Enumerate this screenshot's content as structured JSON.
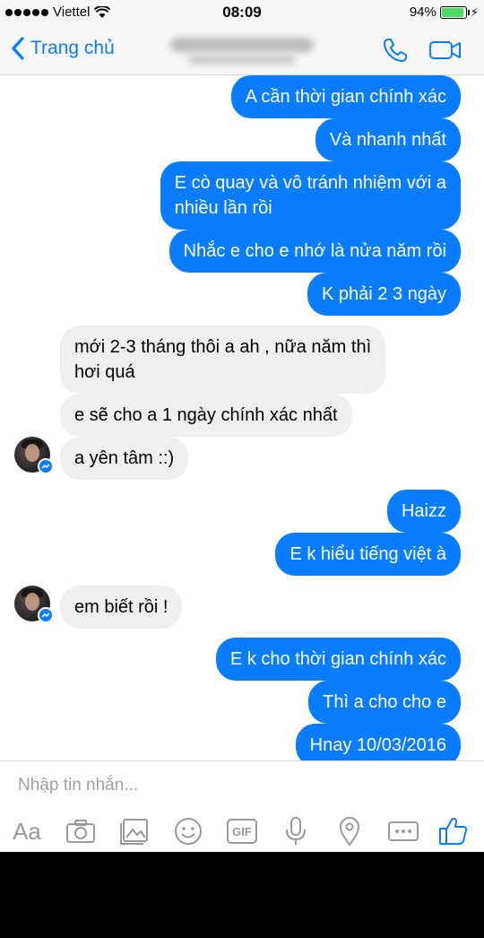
{
  "status_bar": {
    "carrier": "Viettel",
    "time": "08:09",
    "battery_percent": "94%",
    "battery_level": 0.94
  },
  "nav": {
    "back_label": "Trang chủ",
    "contact_name": ""
  },
  "messages": [
    {
      "id": "m1",
      "side": "out",
      "text": "A cần thời gian chính xác"
    },
    {
      "id": "m2",
      "side": "out",
      "text": "Và nhanh nhất"
    },
    {
      "id": "m3",
      "side": "out",
      "text": "E cò quay và vô tránh nhiệm với a\nnhiều lần rồi"
    },
    {
      "id": "m4",
      "side": "out",
      "text": "Nhắc e cho e nhớ là nửa năm rồi"
    },
    {
      "id": "m5",
      "side": "out",
      "text": "K phải 2 3 ngày"
    },
    {
      "id": "m6",
      "side": "in",
      "text": "mới 2-3 tháng thôi a ah , nữa năm thì\nhơi quá"
    },
    {
      "id": "m7",
      "side": "in",
      "text": "e sẽ cho a 1 ngày chính xác nhất"
    },
    {
      "id": "m8",
      "side": "in",
      "text": "a yên tâm ::)"
    },
    {
      "id": "m9",
      "side": "out",
      "text": "Haizz"
    },
    {
      "id": "m10",
      "side": "out",
      "text": "E k hiểu tiếng việt à"
    },
    {
      "id": "m11",
      "side": "in",
      "text": "em biết rồi !"
    },
    {
      "id": "m12",
      "side": "out",
      "text": "E k cho thời gian chính xác"
    },
    {
      "id": "m13",
      "side": "out",
      "text": "Thì a cho cho e"
    },
    {
      "id": "m14",
      "side": "out",
      "text": "Hnay 10/03/2016"
    }
  ],
  "composer": {
    "placeholder": "Nhập tin nhắn...",
    "aa_label": "Aa",
    "gif_label": "GIF",
    "toolbar_icons": [
      "text-format-icon",
      "camera-icon",
      "photo-gallery-icon",
      "sticker-icon",
      "gif-icon",
      "microphone-icon",
      "location-icon",
      "more-icon",
      "like-icon"
    ]
  },
  "colors": {
    "accent": "#0a7cff",
    "outgoing_bubble": "#0a7cff",
    "incoming_bubble": "#efeff1"
  }
}
